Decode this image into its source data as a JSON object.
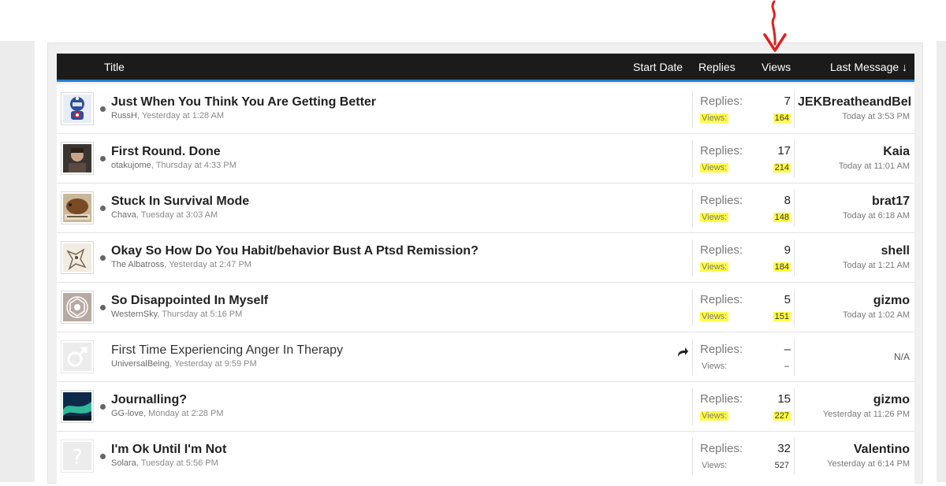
{
  "header": {
    "title": "Title",
    "start_date": "Start Date",
    "replies": "Replies",
    "views": "Views",
    "last_message": "Last Message ↓"
  },
  "accent_colors": {
    "header_bg": "#1b1b1b",
    "header_underline": "#1f7fd6",
    "highlight": "#fffc46",
    "annotation_arrow": "#e0201c"
  },
  "threads": [
    {
      "title": "Just When You Think You Are Getting Better",
      "author": "RussH",
      "started": "Yesterday at 1:28 AM",
      "replies_label": "Replies:",
      "replies": "7",
      "views_label": "Views:",
      "views": "164",
      "last_user": "JEKBreatheandBel",
      "last_date": "Today at 3:53 PM",
      "avatar_icon": "superhero-figure-avatar"
    },
    {
      "title": "First Round. Done",
      "author": "otakujome",
      "started": "Thursday at 4:33 PM",
      "replies_label": "Replies:",
      "replies": "17",
      "views_label": "Views:",
      "views": "214",
      "last_user": "Kaia",
      "last_date": "Today at 11:01 AM",
      "avatar_icon": "person-photo-avatar"
    },
    {
      "title": "Stuck In Survival Mode",
      "author": "Chava",
      "started": "Tuesday at 3:03 AM",
      "replies_label": "Replies:",
      "replies": "8",
      "views_label": "Views:",
      "views": "148",
      "last_user": "brat17",
      "last_date": "Today at 6:18 AM",
      "avatar_icon": "animal-photo-avatar"
    },
    {
      "title": "Okay So How Do You Habit/behavior Bust A Ptsd Remission?",
      "author": "The Albatross",
      "started": "Yesterday at 2:47 PM",
      "replies_label": "Replies:",
      "replies": "9",
      "views_label": "Views:",
      "views": "184",
      "last_user": "shell",
      "last_date": "Today at 1:21 AM",
      "avatar_icon": "bird-sketch-avatar"
    },
    {
      "title": "So Disappointed In Myself",
      "author": "WesternSky",
      "started": "Thursday at 5:16 PM",
      "replies_label": "Replies:",
      "replies": "5",
      "views_label": "Views:",
      "views": "151",
      "last_user": "gizmo",
      "last_date": "Today at 1:02 AM",
      "avatar_icon": "mandala-avatar"
    },
    {
      "title": "First Time Experiencing Anger In Therapy",
      "author": "UniversalBeing",
      "started": "Yesterday at 9:59 PM",
      "replies_label": "Replies:",
      "replies": "–",
      "views_label": "Views:",
      "views": "–",
      "last_na": "N/A",
      "avatar_icon": "male-default-avatar"
    },
    {
      "title": "Journalling?",
      "author": "GG-love",
      "started": "Monday at 2:28 PM",
      "replies_label": "Replies:",
      "replies": "15",
      "views_label": "Views:",
      "views": "227",
      "last_user": "gizmo",
      "last_date": "Yesterday at 11:26 PM",
      "avatar_icon": "aurora-photo-avatar"
    },
    {
      "title": "I'm Ok Until I'm Not",
      "author": "Solara",
      "started": "Tuesday at 5:56 PM",
      "replies_label": "Replies:",
      "replies": "32",
      "views_label": "Views:",
      "views": "527",
      "last_user": "Valentino",
      "last_date": "Yesterday at 6:14 PM",
      "avatar_icon": "unknown-default-avatar"
    }
  ]
}
